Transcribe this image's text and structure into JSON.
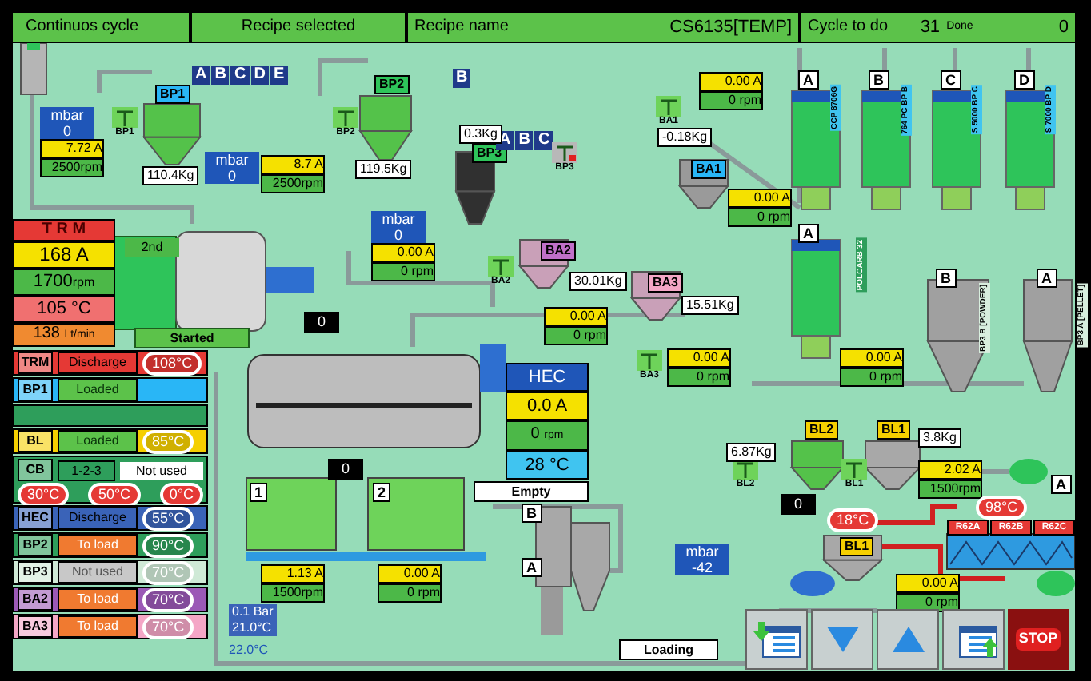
{
  "top_bar": {
    "mode": "Continuos cycle",
    "recipe_selected_label": "Recipe selected",
    "recipe_name_label": "Recipe name",
    "recipe_name": "CS6135[TEMP]",
    "cycle_label": "Cycle to do",
    "cycle_count": "31",
    "done_label": "Done",
    "done_count": "0"
  },
  "trm": {
    "title": "T R M",
    "current": "168 A",
    "speed": "1700",
    "speed_unit": "rpm",
    "temperature": "105 °C",
    "flow": "138",
    "flow_unit": "Lt/min"
  },
  "status_rows": [
    {
      "kind": "device",
      "tag": "TRM",
      "color": "#e53935",
      "status": {
        "label": "Discharge",
        "kind": "discharge"
      },
      "temperature": "108°C"
    },
    {
      "kind": "device",
      "tag": "BP1",
      "color": "#29b6f6",
      "status": {
        "label": "Loaded",
        "kind": "loaded"
      }
    },
    {
      "kind": "spacer",
      "color": "#2e9e5b"
    },
    {
      "kind": "device",
      "tag": "BL",
      "color": "#f5cf00",
      "status": {
        "label": "Loaded",
        "kind": "loaded"
      },
      "temperature": "85°C"
    },
    {
      "kind": "cb",
      "tag": "CB",
      "color": "#2e9e5b",
      "steps": "1-2-3",
      "note": "Not used",
      "temperatures": [
        "30°C",
        "50°C",
        "0°C"
      ]
    },
    {
      "kind": "device",
      "tag": "HEC",
      "color": "#3a63b8",
      "status": {
        "label": "Discharge",
        "kind": "discharge"
      },
      "temperature": "55°C"
    },
    {
      "kind": "device",
      "tag": "BP2",
      "color": "#2e9e5b",
      "status": {
        "label": "To load",
        "kind": "to_load"
      },
      "temperature": "90°C"
    },
    {
      "kind": "device",
      "tag": "BP3",
      "color": "#cfe9d6",
      "status": {
        "label": "Not used",
        "kind": "not_used"
      },
      "temperature": "70°C"
    },
    {
      "kind": "device",
      "tag": "BA2",
      "color": "#9b59b6",
      "status": {
        "label": "To load",
        "kind": "to_load"
      },
      "temperature": "70°C"
    },
    {
      "kind": "device",
      "tag": "BA3",
      "color": "#f4a6c6",
      "status": {
        "label": "To load",
        "kind": "to_load"
      },
      "temperature": "70°C"
    }
  ],
  "canvas": {
    "tags": [
      {
        "label": "BP1",
        "color": "#29b6f6"
      },
      {
        "label": "BP2",
        "color": "#2ec45a"
      },
      {
        "label": "BP3",
        "color": "#2ec45a"
      },
      {
        "label": "BA1",
        "color": "#29b6f6"
      },
      {
        "label": "BA2",
        "color": "#c070c8"
      },
      {
        "label": "BA3",
        "color": "#f4a6c6"
      },
      {
        "label": "BL2",
        "color": "#f5cf00"
      },
      {
        "label": "BL1",
        "color": "#f5cf00"
      },
      {
        "label": "BL1",
        "color": "#f5cf00"
      }
    ],
    "valve_letters": [
      [
        "A",
        "B",
        "C",
        "D",
        "E"
      ],
      [
        "B"
      ],
      [
        "A",
        "B",
        "C"
      ]
    ],
    "markers": [
      "A",
      "B",
      "C",
      "D",
      "A",
      "B",
      "A",
      "B",
      "A",
      "A",
      "1",
      "2"
    ],
    "sensor_icons": [
      {
        "label": "BP1",
        "alarm": false
      },
      {
        "label": "BP2",
        "alarm": false
      },
      {
        "label": "BP3",
        "alarm": true
      },
      {
        "label": "BA1",
        "alarm": false
      },
      {
        "label": "BA2",
        "alarm": false
      },
      {
        "label": "BA3",
        "alarm": false
      },
      {
        "label": "BL2",
        "alarm": false
      },
      {
        "label": "BL1",
        "alarm": false
      }
    ],
    "weights": [
      "110.4Kg",
      "119.5Kg",
      "0.3Kg",
      "-0.18Kg",
      "30.01Kg",
      "15.51Kg",
      "6.87Kg",
      "3.8Kg"
    ],
    "drives": [
      {
        "current": "7.72 A",
        "speed": "2500rpm"
      },
      {
        "current": "8.7 A",
        "speed": "2500rpm"
      },
      {
        "current": "0.00 A",
        "speed": "0 rpm"
      },
      {
        "current": "0.00 A",
        "speed": "0 rpm"
      },
      {
        "current": "0.00 A",
        "speed": "0 rpm"
      },
      {
        "current": "0.00 A",
        "speed": "0 rpm"
      },
      {
        "current": "0.00 A",
        "speed": "0 rpm"
      },
      {
        "current": "0.00 A",
        "speed": "0 rpm"
      },
      {
        "current": "2.02 A",
        "speed": "1500rpm"
      },
      {
        "current": "1.13 A",
        "speed": "1500rpm"
      },
      {
        "current": "0.00 A",
        "speed": "0 rpm"
      },
      {
        "current": "0.00 A",
        "speed": "0 rpm"
      }
    ],
    "vacuum_gauges": [
      {
        "unit": "mbar",
        "value": "0"
      },
      {
        "unit": "mbar",
        "value": "0"
      },
      {
        "unit": "mbar",
        "value": "0"
      },
      {
        "unit": "mbar",
        "value": "-42"
      }
    ],
    "counters": [
      "0",
      "0",
      "0"
    ],
    "state_labels": [
      {
        "label": "Started",
        "kind": "running"
      },
      {
        "label": "Empty",
        "kind": "idle"
      },
      {
        "label": "Loading",
        "kind": "idle"
      }
    ],
    "mixer_stage": "2nd",
    "hec": {
      "title": "HEC",
      "current": "0.0 A",
      "speed": "0",
      "speed_unit": "rpm",
      "temperature": "28 °C"
    },
    "temperatures": [
      "18°C",
      "98°C"
    ],
    "heater_zones": [
      "R62A",
      "R62B",
      "R62C"
    ],
    "cooling": {
      "pressure": "0.1 Bar",
      "temperature": "21.0°C",
      "ambient": "22.0°C"
    },
    "silo_names": [
      "CCP 8706G",
      "764 PC BP B",
      "S 5000 BP C",
      "S 7000 BP D",
      "POLCARB 32",
      "BP3 B [POWDER]",
      "BP3 A [PELLET]"
    ]
  },
  "nav_buttons": [
    {
      "kind": "download"
    },
    {
      "kind": "down"
    },
    {
      "kind": "up"
    },
    {
      "kind": "upload"
    },
    {
      "kind": "stop",
      "label": "STOP"
    }
  ]
}
